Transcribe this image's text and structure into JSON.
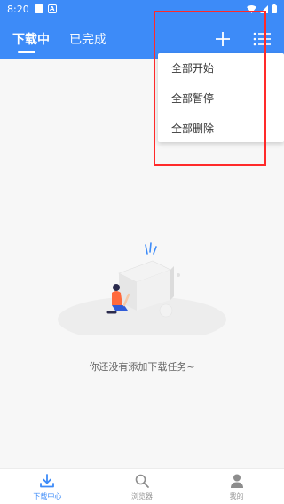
{
  "status_bar": {
    "time": "8:20"
  },
  "tabs": [
    {
      "label": "下载中",
      "active": true
    },
    {
      "label": "已完成",
      "active": false
    }
  ],
  "header_icons": [
    "plus-icon",
    "list-icon"
  ],
  "menu": {
    "items": [
      {
        "label": "全部开始"
      },
      {
        "label": "全部暂停"
      },
      {
        "label": "全部删除"
      }
    ]
  },
  "empty_state": {
    "text": "你还没有添加下载任务~"
  },
  "bottom_nav": [
    {
      "label": "下载中心",
      "icon": "download-icon",
      "active": true
    },
    {
      "label": "浏览器",
      "icon": "search-icon",
      "active": false
    },
    {
      "label": "我的",
      "icon": "person-icon",
      "active": false
    }
  ],
  "colors": {
    "primary": "#3d8bf8",
    "highlight": "#ff2a2a"
  }
}
